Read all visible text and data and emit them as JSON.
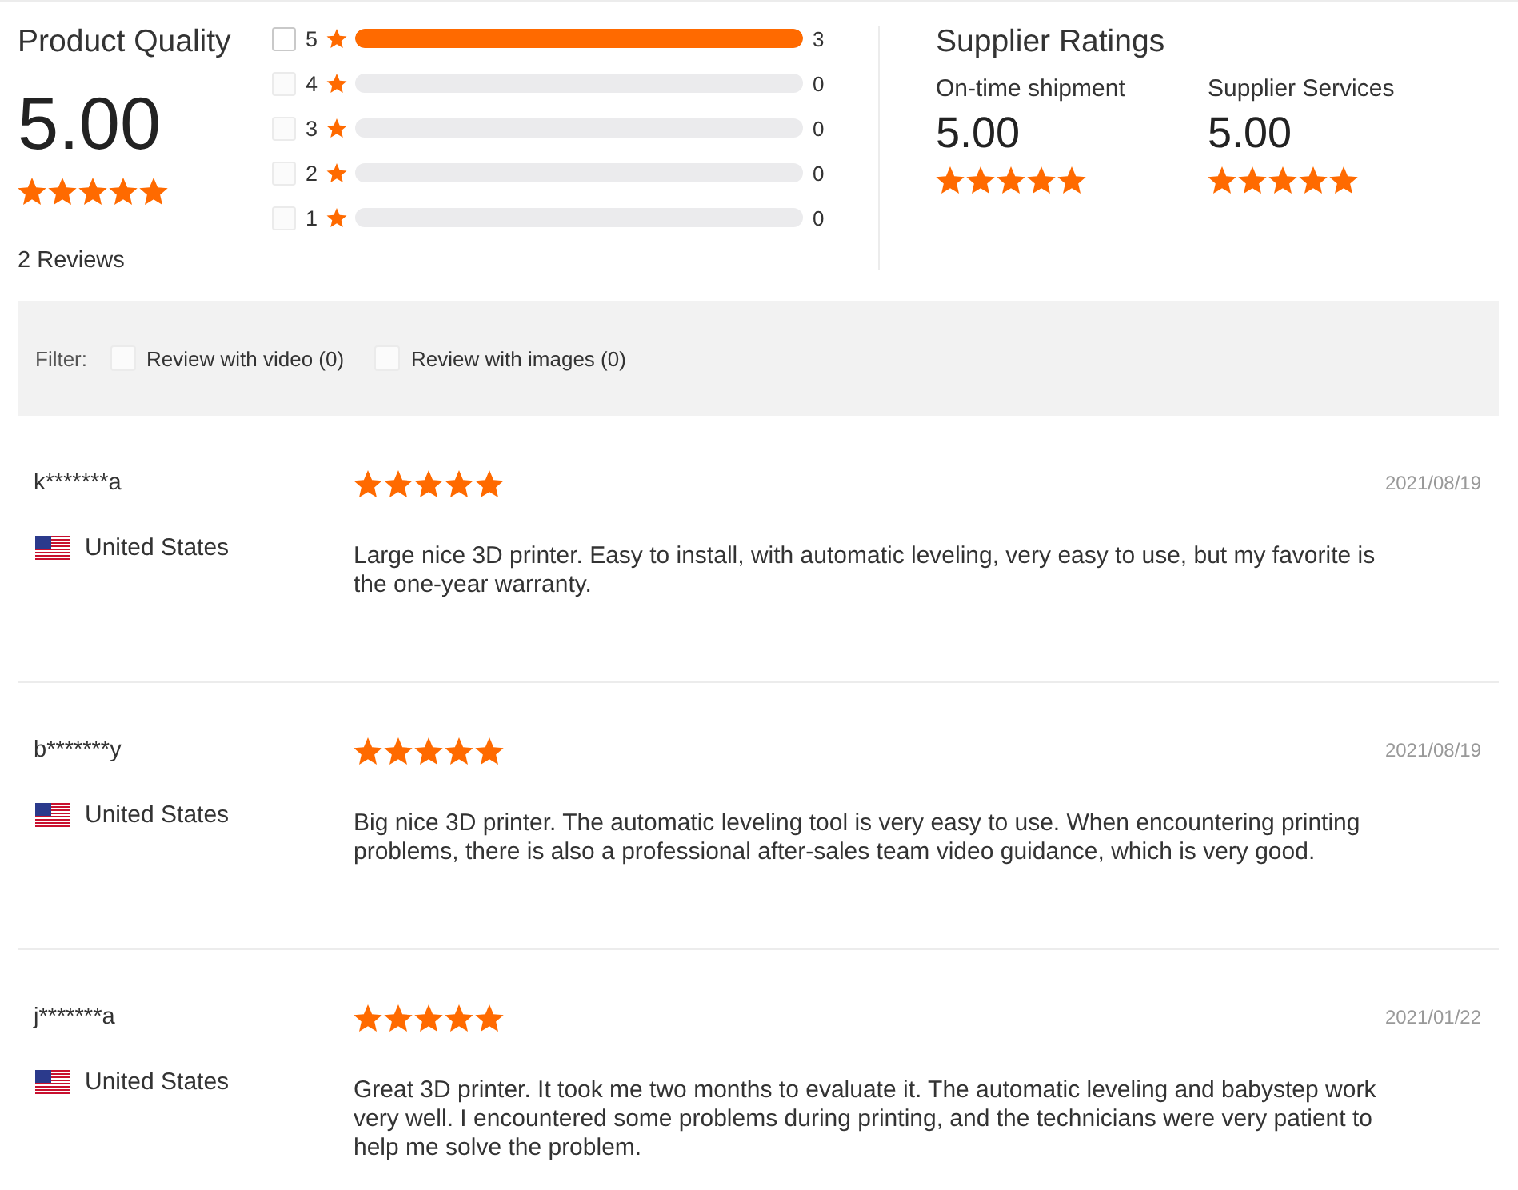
{
  "product_quality": {
    "title": "Product Quality",
    "score": "5.00",
    "stars": 5,
    "reviews": "2 Reviews"
  },
  "rating_breakdown": [
    {
      "label": "5",
      "count": "3",
      "level": 1,
      "checked": false,
      "disabled": false
    },
    {
      "label": "4",
      "count": "0",
      "level": 0,
      "checked": false,
      "disabled": true
    },
    {
      "label": "3",
      "count": "0",
      "level": 0,
      "checked": false,
      "disabled": true
    },
    {
      "label": "2",
      "count": "0",
      "level": 0,
      "checked": false,
      "disabled": true
    },
    {
      "label": "1",
      "count": "0",
      "level": 0,
      "checked": false,
      "disabled": true
    }
  ],
  "supplier_ratings": {
    "title": "Supplier Ratings",
    "metrics": [
      {
        "label": "On-time shipment",
        "score": "5.00",
        "stars": 5
      },
      {
        "label": "Supplier Services",
        "score": "5.00",
        "stars": 5
      }
    ]
  },
  "filter": {
    "label": "Filter:",
    "options": [
      {
        "label": "Review with video (0)",
        "checked": false,
        "disabled": true
      },
      {
        "label": "Review with images (0)",
        "checked": false,
        "disabled": true
      }
    ]
  },
  "reviews": [
    {
      "name": "k*******a",
      "country": "United States",
      "stars": 5,
      "date": "2021/08/19",
      "text": "Large nice 3D printer. Easy to install, with automatic leveling, very easy to use, but my favorite is the one-year warranty."
    },
    {
      "name": "b*******y",
      "country": "United States",
      "stars": 5,
      "date": "2021/08/19",
      "text": "Big nice 3D printer. The automatic leveling tool is very easy to use. When encountering printing problems, there is also a professional after-sales team video guidance, which is very good."
    },
    {
      "name": "j*******a",
      "country": "United States",
      "stars": 5,
      "date": "2021/01/22",
      "text": "Great 3D printer. It took me two months to evaluate it. The automatic leveling and babystep work very well. I encountered some problems during printing, and the technicians were very patient to help me solve the problem."
    }
  ]
}
